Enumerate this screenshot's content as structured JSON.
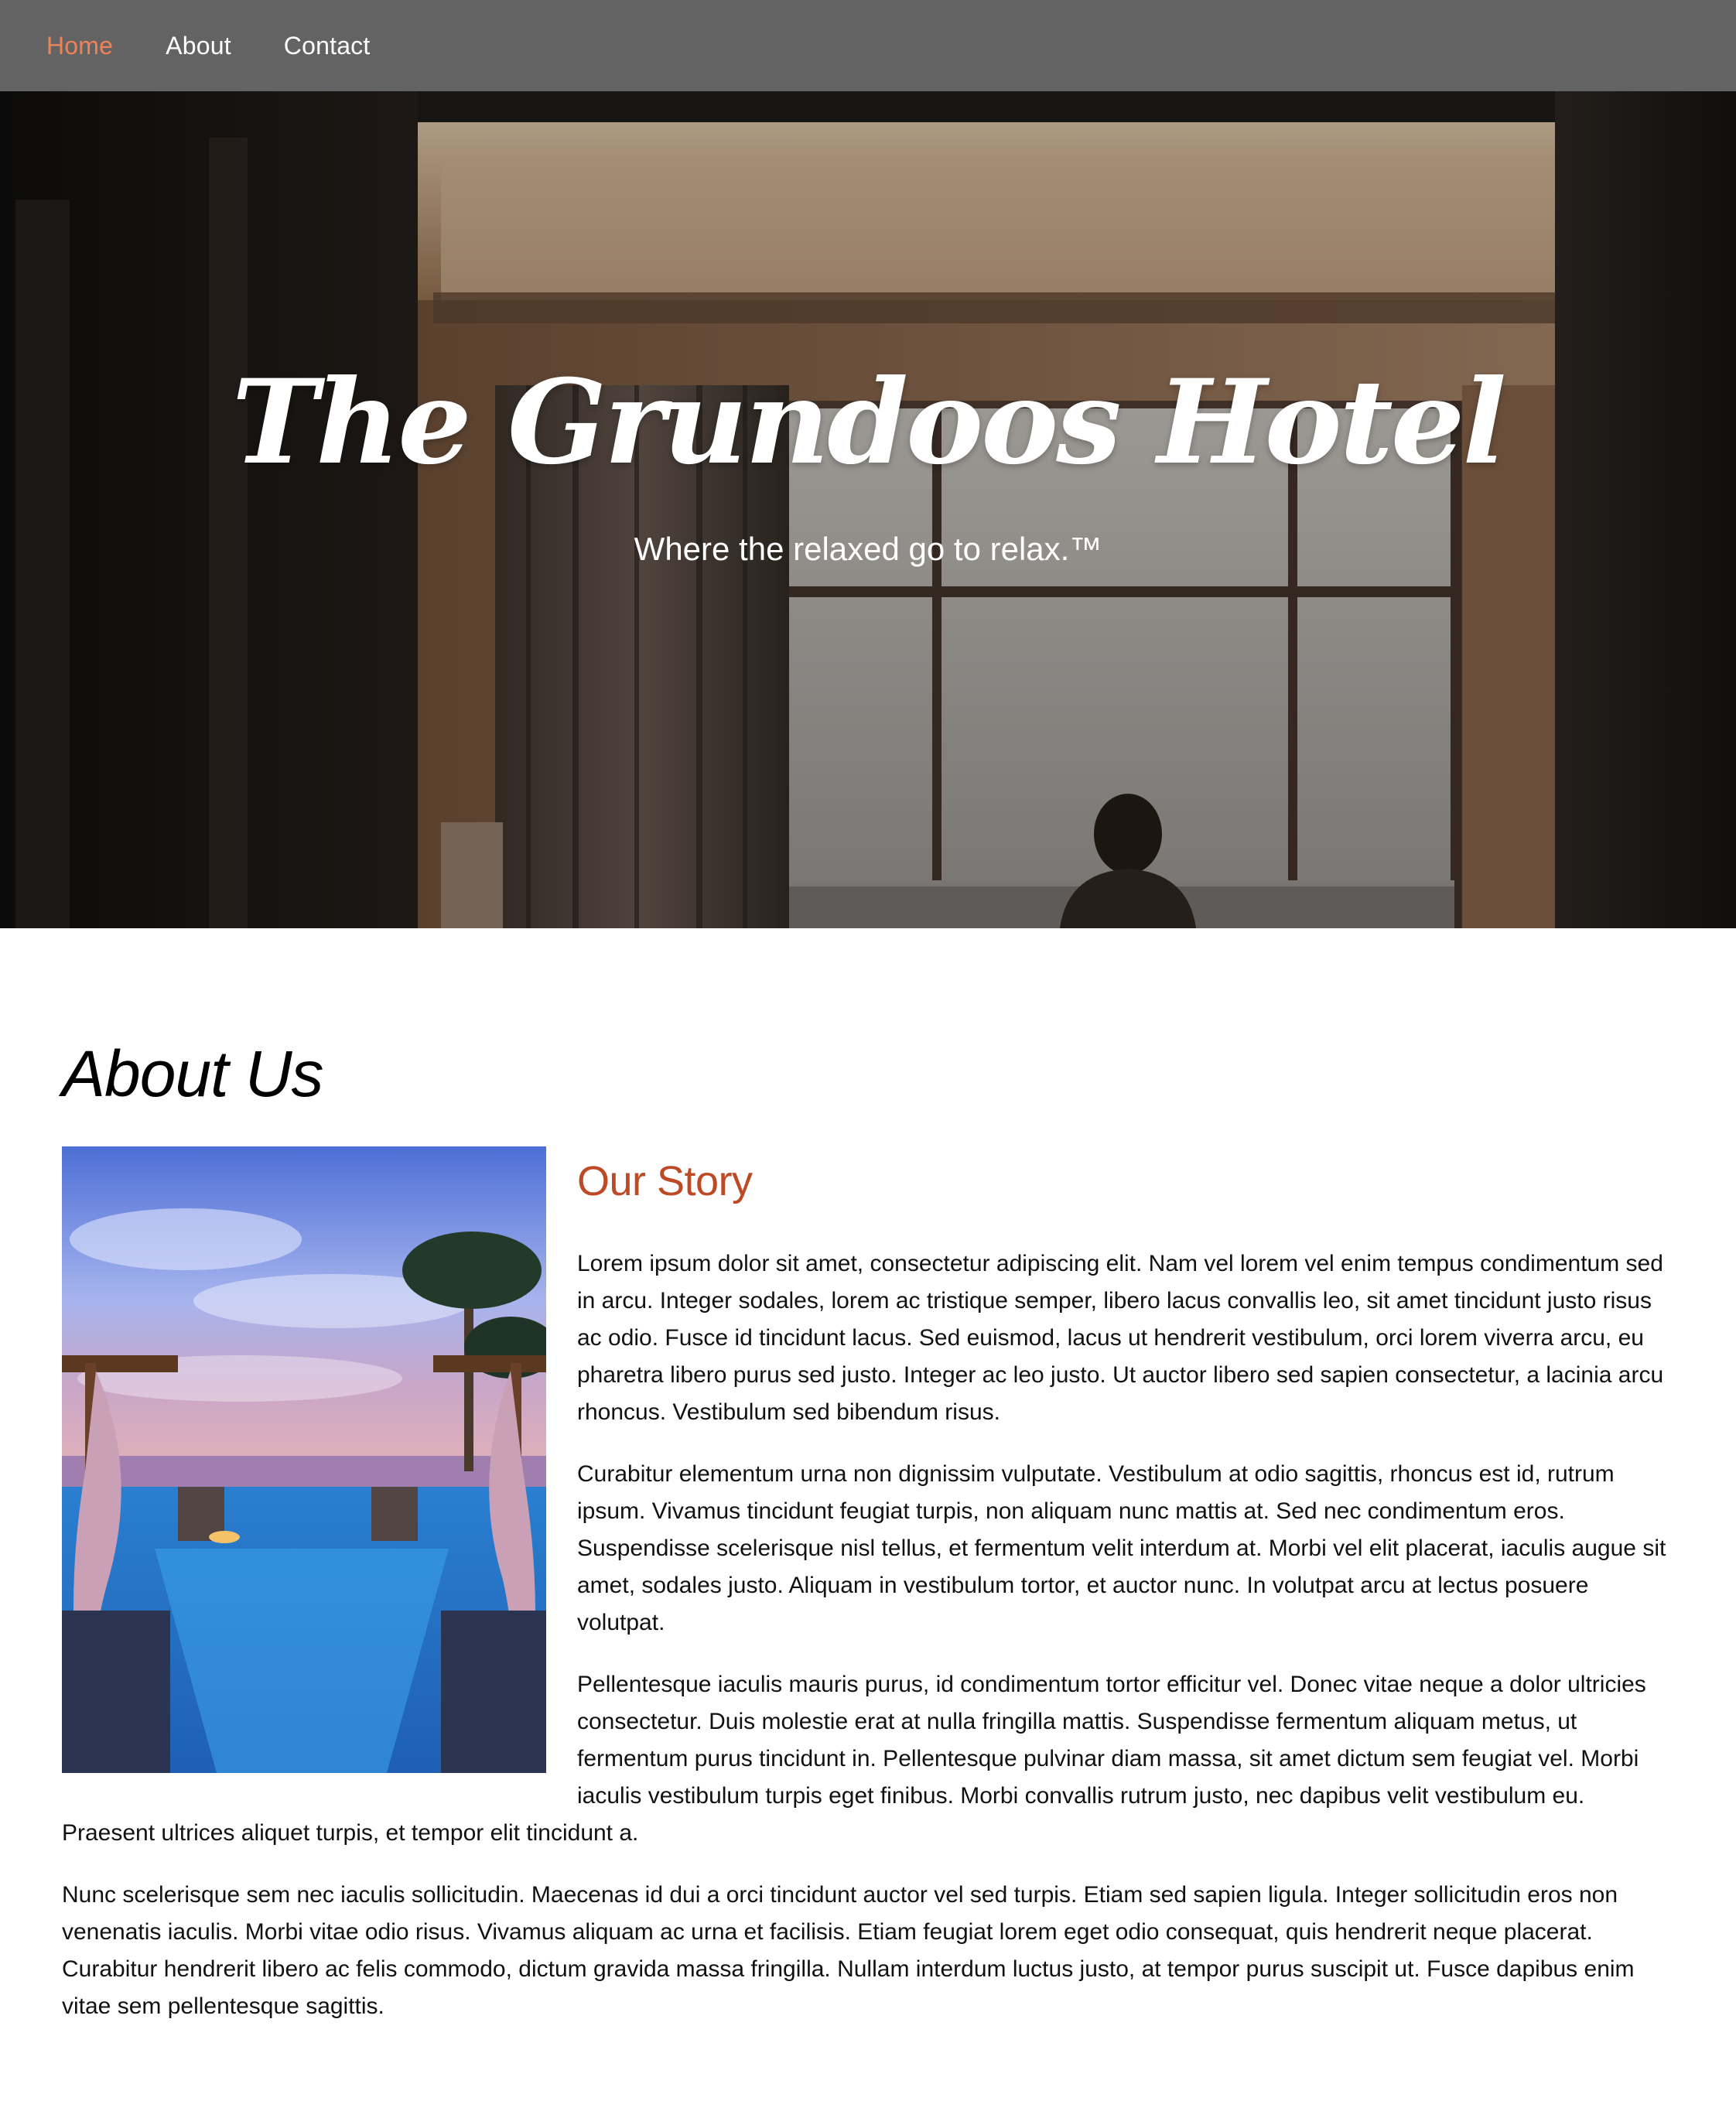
{
  "nav": {
    "items": [
      {
        "label": "Home",
        "active": true
      },
      {
        "label": "About",
        "active": false
      },
      {
        "label": "Contact",
        "active": false
      }
    ],
    "active_color": "#ee8358",
    "background": "#636363"
  },
  "hero": {
    "title": "The Grundoos Hotel",
    "tagline": "Where the relaxed go to relax.™"
  },
  "about": {
    "heading": "About Us",
    "story_title": "Our Story",
    "story_title_color": "#bd4a24",
    "paragraphs": [
      "Lorem ipsum dolor sit amet, consectetur adipiscing elit. Nam vel lorem vel enim tempus condimentum sed in arcu. Integer sodales, lorem ac tristique semper, libero lacus convallis leo, sit amet tincidunt justo risus ac odio. Fusce id tincidunt lacus. Sed euismod, lacus ut hendrerit vestibulum, orci lorem viverra arcu, eu pharetra libero purus sed justo. Integer ac leo justo. Ut auctor libero sed sapien consectetur, a lacinia arcu rhoncus. Vestibulum sed bibendum risus.",
      "Curabitur elementum urna non dignissim vulputate. Vestibulum at odio sagittis, rhoncus est id, rutrum ipsum. Vivamus tincidunt feugiat turpis, non aliquam nunc mattis at. Sed nec condimentum eros. Suspendisse scelerisque nisl tellus, et fermentum velit interdum at. Morbi vel elit placerat, iaculis augue sit amet, sodales justo. Aliquam in vestibulum tortor, et auctor nunc. In volutpat arcu at lectus posuere volutpat.",
      "Pellentesque iaculis mauris purus, id condimentum tortor efficitur vel. Donec vitae neque a dolor ultricies consectetur. Duis molestie erat at nulla fringilla mattis. Suspendisse fermentum aliquam metus, ut fermentum purus tincidunt in. Pellentesque pulvinar diam massa, sit amet dictum sem feugiat vel. Morbi iaculis vestibulum turpis eget finibus. Morbi convallis rutrum justo, nec dapibus velit vestibulum eu. Praesent ultrices aliquet turpis, et tempor elit tincidunt a.",
      "Nunc scelerisque sem nec iaculis sollicitudin. Maecenas id dui a orci tincidunt auctor vel sed turpis. Etiam sed sapien ligula. Integer sollicitudin eros non venenatis iaculis. Morbi vitae odio risus. Vivamus aliquam ac urna et facilisis. Etiam feugiat lorem eget odio consequat, quis hendrerit neque placerat. Curabitur hendrerit libero ac felis commodo, dictum gravida massa fringilla. Nullam interdum luctus justo, at tempor purus suscipit ut. Fusce dapibus enim vitae sem pellentesque sagittis."
    ]
  }
}
